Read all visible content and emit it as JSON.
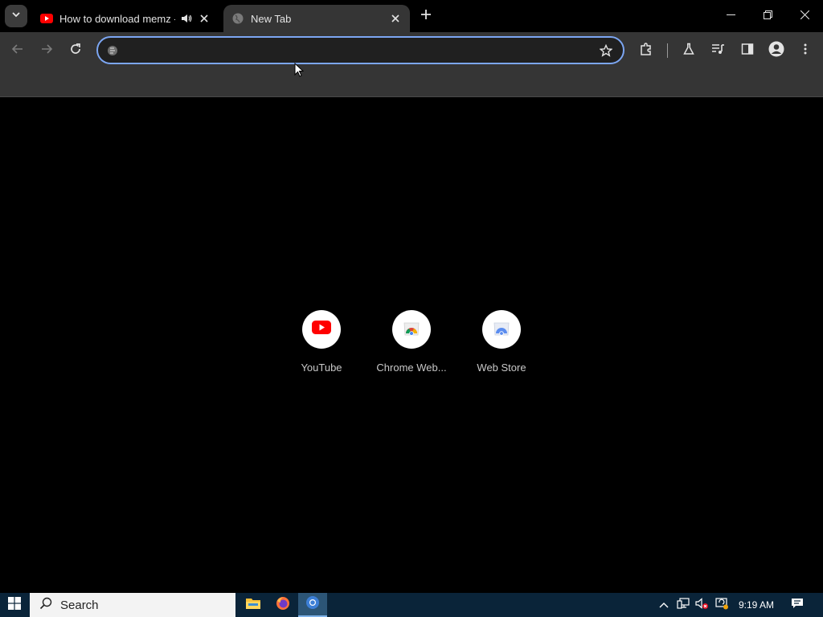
{
  "tabs": [
    {
      "title": "How to download memz -",
      "favicon": "youtube-icon",
      "active": false,
      "audio": true
    },
    {
      "title": "New Tab",
      "favicon": "globe-icon",
      "active": true,
      "audio": false
    }
  ],
  "omnibox": {
    "value": "",
    "placeholder": ""
  },
  "shortcuts": [
    {
      "label": "YouTube",
      "icon": "youtube-icon"
    },
    {
      "label": "Chrome Web...",
      "icon": "chrome-web-store-icon"
    },
    {
      "label": "Web Store",
      "icon": "web-store-icon"
    }
  ],
  "taskbar": {
    "search_label": "Search",
    "clock": "9:19 AM",
    "apps": [
      "file-explorer-icon",
      "firefox-icon",
      "chrome-icon"
    ]
  },
  "colors": {
    "accent": "#7ca6f2",
    "toolbar": "#353535",
    "taskbar": "#0a2439",
    "youtube_red": "#ff0000"
  }
}
